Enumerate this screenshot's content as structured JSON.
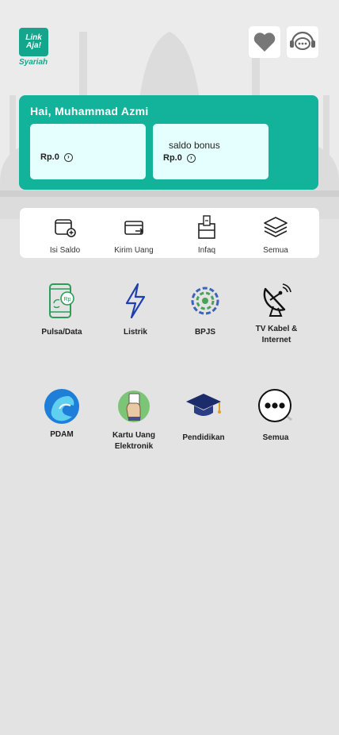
{
  "header": {
    "logo_line1": "Link",
    "logo_line2": "Aja!",
    "logo_sub": "Syariah",
    "favorite_icon": "heart-icon",
    "help_icon": "chat-support-icon"
  },
  "balance": {
    "greeting": "Hai, Muhammad Azmi",
    "main_value": "Rp.0",
    "bonus_label": "saldo bonus",
    "bonus_value": "Rp.0"
  },
  "quick_menu": [
    {
      "label": "Isi Saldo",
      "icon": "wallet-topup-icon"
    },
    {
      "label": "Kirim Uang",
      "icon": "send-money-icon"
    },
    {
      "label": "Infaq",
      "icon": "donation-box-icon"
    },
    {
      "label": "Semua",
      "icon": "layers-icon"
    }
  ],
  "services": [
    {
      "label": "Pulsa/Data",
      "icon": "phone-credit-icon"
    },
    {
      "label": "Listrik",
      "icon": "lightning-icon"
    },
    {
      "label": "BPJS",
      "icon": "bpjs-icon"
    },
    {
      "label": "TV Kabel & Internet",
      "icon": "satellite-dish-icon"
    },
    {
      "label": "PDAM",
      "icon": "water-drop-icon"
    },
    {
      "label": "Kartu Uang Elektronik",
      "icon": "e-money-card-icon"
    },
    {
      "label": "Pendidikan",
      "icon": "graduation-cap-icon"
    },
    {
      "label": "Semua",
      "icon": "more-icon"
    }
  ],
  "colors": {
    "brand": "#13b29b",
    "card_bg": "#e4fffd",
    "page_bg": "#e3e3e3"
  }
}
